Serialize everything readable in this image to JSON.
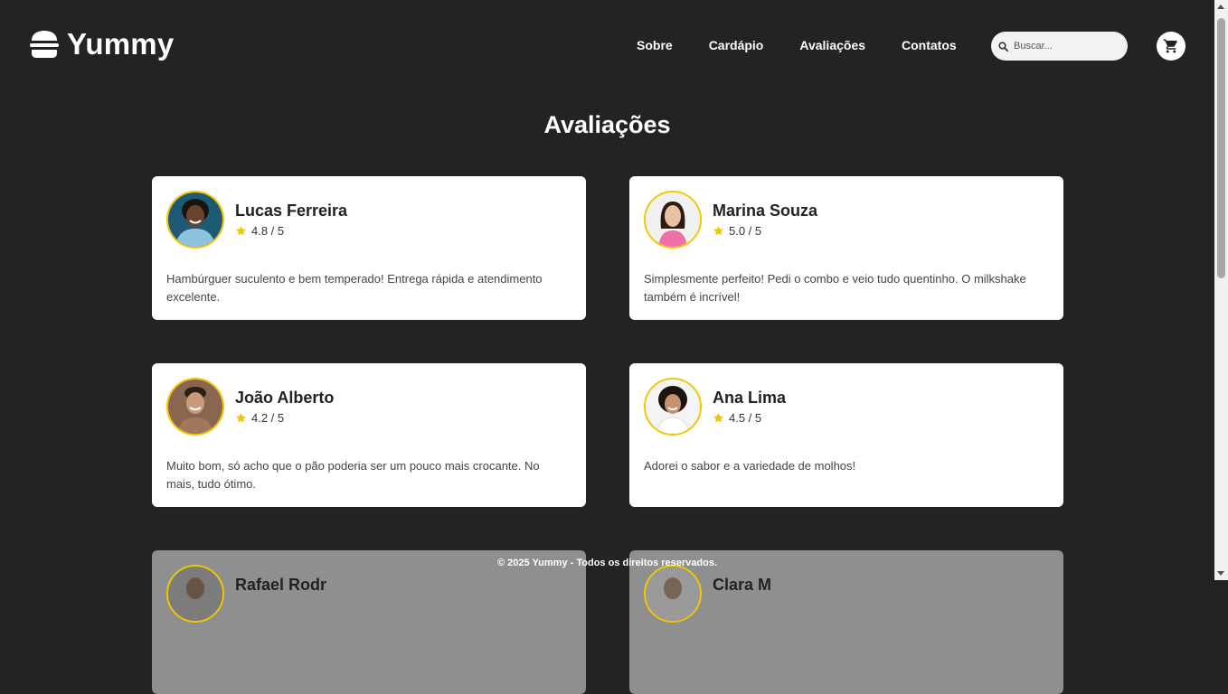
{
  "brand": {
    "name": "Yummy",
    "logo_icon": "burger-icon"
  },
  "nav": {
    "items": [
      "Sobre",
      "Cardápio",
      "Avaliações",
      "Contatos"
    ]
  },
  "search": {
    "placeholder": "Buscar..."
  },
  "cart": {
    "icon": "cart-icon"
  },
  "page_title": "Avaliações",
  "reviews": [
    {
      "name": "Lucas Ferreira",
      "rating": "4.8 / 5",
      "comment": "Hambúrguer suculento e bem temperado! Entrega rápida e atendimento excelente."
    },
    {
      "name": "Marina Souza",
      "rating": "5.0 / 5",
      "comment": "Simplesmente perfeito! Pedi o combo e veio tudo quentinho. O milkshake também é incrível!"
    },
    {
      "name": "João Alberto",
      "rating": "4.2 / 5",
      "comment": "Muito bom, só acho que o pão poderia ser um pouco mais crocante. No mais, tudo ótimo."
    },
    {
      "name": "Ana Lima",
      "rating": "4.5 / 5",
      "comment": "Adorei o sabor e a variedade de molhos!"
    },
    {
      "name": "Rafael Rodr",
      "rating": "",
      "comment": ""
    },
    {
      "name": "Clara M",
      "rating": "",
      "comment": ""
    }
  ],
  "footer": "© 2025 Yummy - Todos os direitos reservados.",
  "colors": {
    "background": "#232323",
    "accent": "#f2c600",
    "card": "#ffffff"
  }
}
